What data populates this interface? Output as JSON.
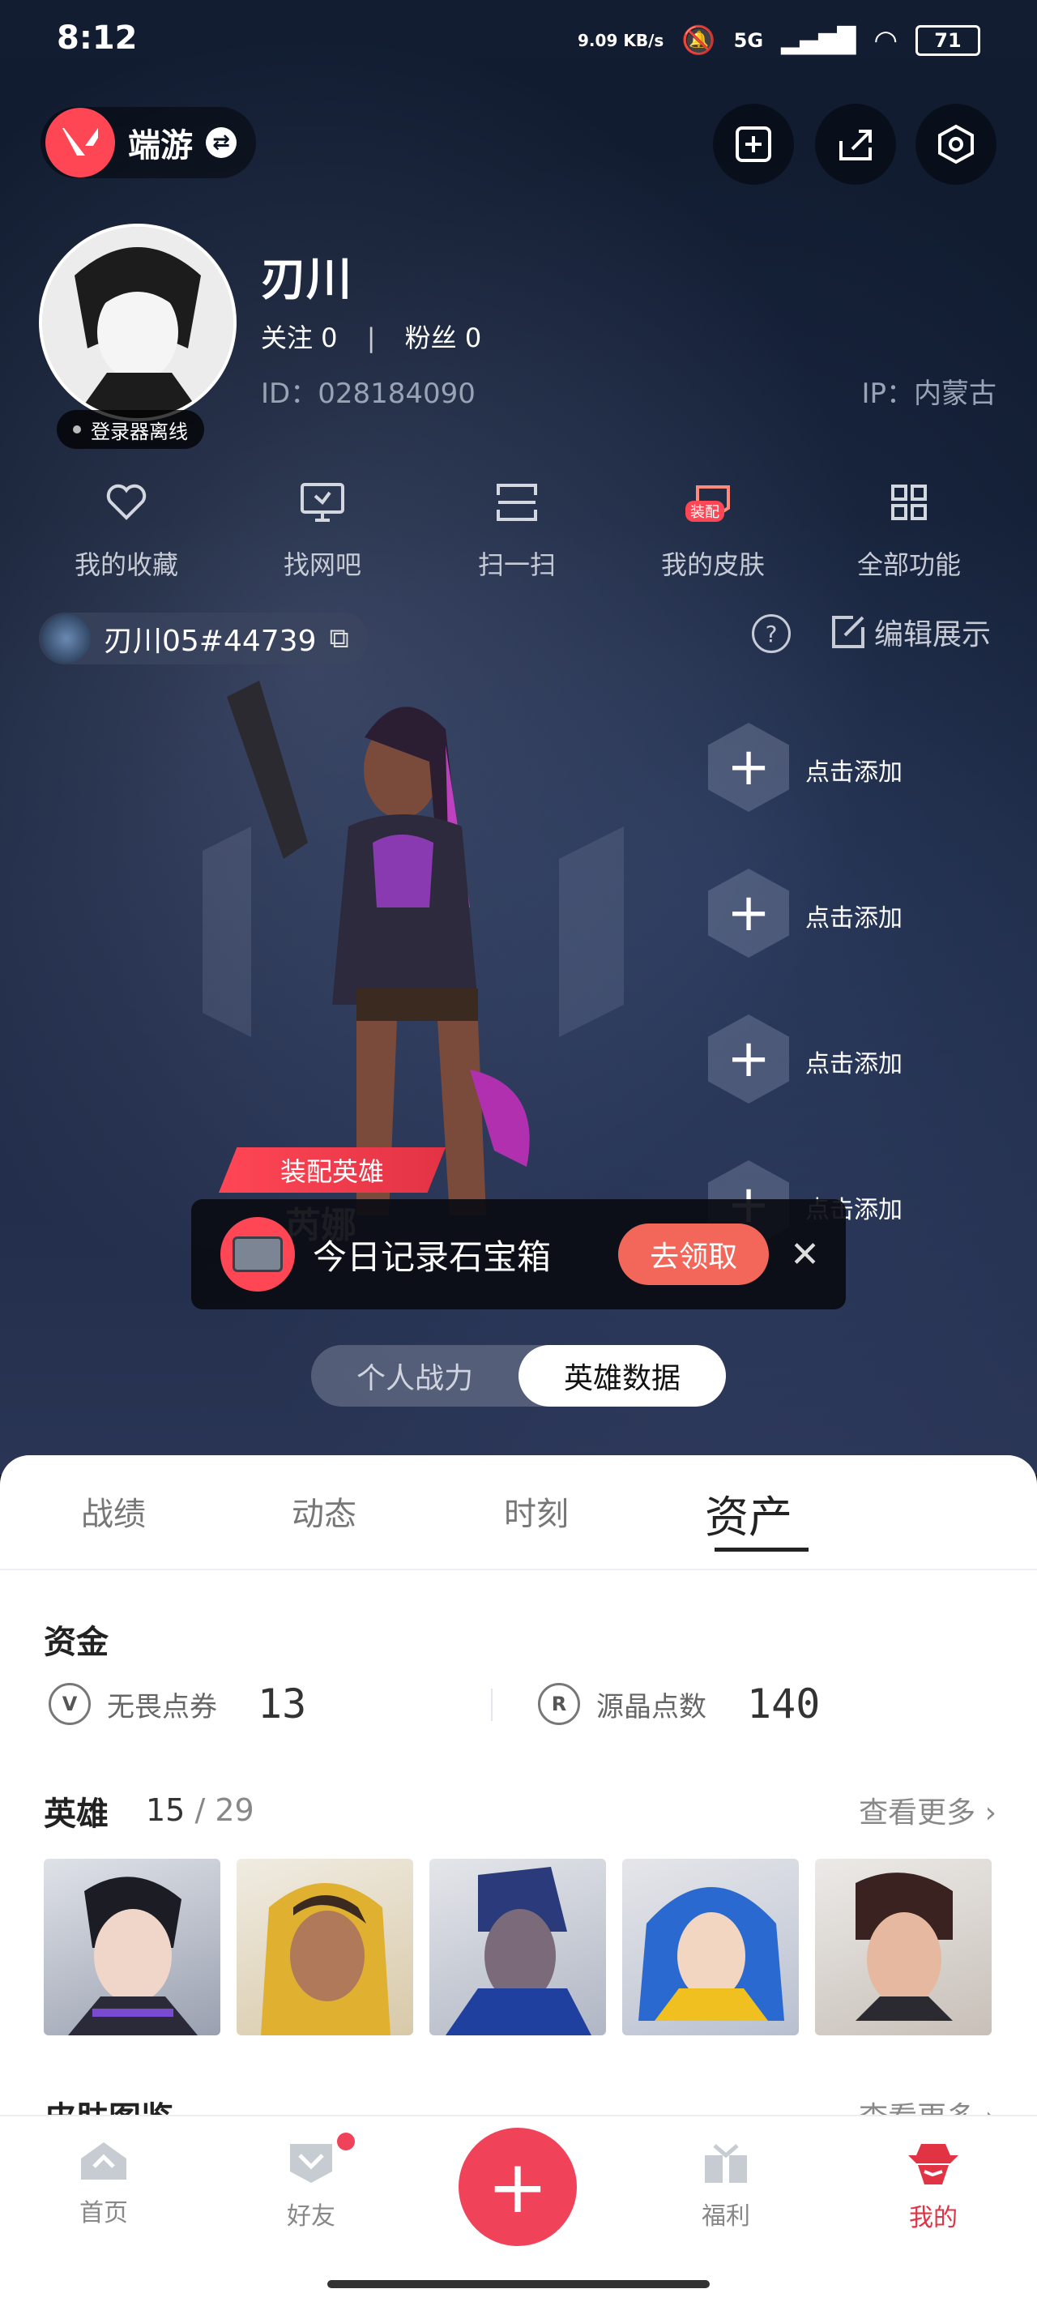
{
  "status_bar": {
    "time": "8:12",
    "net_speed": "9.09 KB/s",
    "signal": "5G",
    "battery": "71"
  },
  "header": {
    "app_name": "端游"
  },
  "profile": {
    "name": "刃川",
    "follow_label": "关注 0",
    "fans_label": "粉丝 0",
    "id_text": "ID：028184090",
    "ip_text": "IP：内蒙古",
    "status": "登录器离线"
  },
  "quick_actions": [
    {
      "label": "我的收藏",
      "icon": "heart-icon"
    },
    {
      "label": "找网吧",
      "icon": "monitor-icon"
    },
    {
      "label": "扫一扫",
      "icon": "scan-icon"
    },
    {
      "label": "我的皮肤",
      "icon": "skin-icon",
      "badge": "装配"
    },
    {
      "label": "全部功能",
      "icon": "grid-icon"
    }
  ],
  "account": {
    "riot_id": "刃川05#44739",
    "edit_label": "编辑展示"
  },
  "slots": {
    "add_label": "点击添加"
  },
  "hero": {
    "equip_tag": "装配英雄",
    "name": "芮娜"
  },
  "toast": {
    "text": "今日记录石宝箱",
    "claim_label": "去领取"
  },
  "segment": {
    "left": "个人战力",
    "right": "英雄数据",
    "active": "right"
  },
  "tabs": [
    {
      "label": "战绩"
    },
    {
      "label": "动态"
    },
    {
      "label": "时刻"
    },
    {
      "label": "资产",
      "active": true
    }
  ],
  "assets": {
    "funds_title": "资金",
    "currency_vp_label": "无畏点券",
    "currency_vp_value": "13",
    "currency_rp_label": "源晶点数",
    "currency_rp_value": "140"
  },
  "heroes": {
    "title": "英雄",
    "owned": "15",
    "total": "/ 29",
    "more_label": "查看更多"
  },
  "skins": {
    "title": "皮肤图鉴",
    "more_label": "查看更多"
  },
  "nav": {
    "home": "首页",
    "friends": "好友",
    "welfare": "福利",
    "me": "我的"
  },
  "colors": {
    "accent": "#ff4655",
    "claim": "#f2675a",
    "active_nav": "#e23345"
  }
}
